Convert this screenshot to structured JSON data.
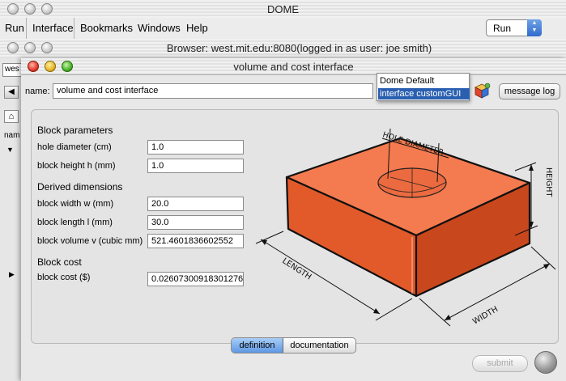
{
  "dome_window": {
    "title": "DOME"
  },
  "menubar": {
    "items": [
      "Run",
      "Interface",
      "Bookmarks",
      "Windows",
      "Help"
    ],
    "run_select": "Run"
  },
  "browser_window": {
    "title": "Browser: west.mit.edu:8080(logged in as user: joe smith)",
    "address_partial": "wes",
    "col_header_partial": "nam"
  },
  "interface_window": {
    "title": "volume and cost interface",
    "name_label": "name:",
    "name_value": "volume and cost interface",
    "message_log_label": "message log",
    "view_menu": {
      "options": [
        "Dome Default",
        "interface customGUI"
      ],
      "selected": "interface customGUI"
    },
    "sections": {
      "block_params": "Block parameters",
      "derived": "Derived dimensions",
      "cost": "Block cost"
    },
    "fields": {
      "hole_diameter": {
        "label": "hole diameter (cm)",
        "value": "1.0"
      },
      "block_height": {
        "label": "block height h (mm)",
        "value": "1.0"
      },
      "block_width": {
        "label": "block width w (mm)",
        "value": "20.0"
      },
      "block_length": {
        "label": "block length l (mm)",
        "value": "30.0"
      },
      "block_volume": {
        "label": "block volume v (cubic mm)",
        "value": "521.4601836602552"
      },
      "block_cost": {
        "label": "block cost ($)",
        "value": "0.02607300918301276"
      }
    },
    "drawing_labels": {
      "hole": "HOLE DIAMETER",
      "height": "HEIGHT",
      "length": "LENGTH",
      "width": "WIDTH"
    },
    "tabs": [
      "definition",
      "documentation"
    ],
    "active_tab": "definition",
    "submit_label": "submit"
  },
  "colors": {
    "block_top": "#f47a4f",
    "block_front": "#e25a2a",
    "block_side": "#c9471d",
    "selection": "#2a5fb0"
  }
}
